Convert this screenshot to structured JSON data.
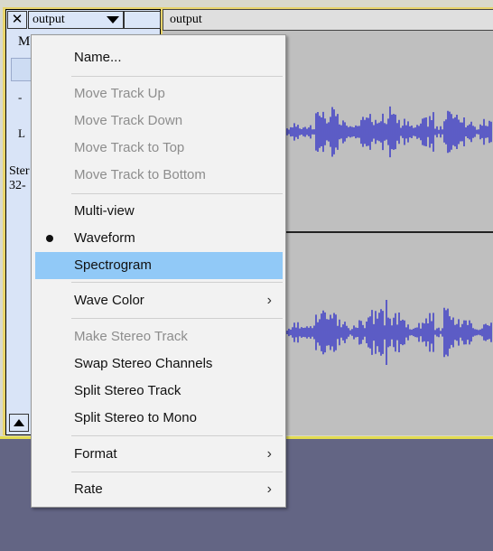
{
  "track": {
    "close_label": "✕",
    "name_label": "output",
    "wave_title": "output",
    "mute_partial": "M",
    "gain_partial": "-",
    "pan_partial": "L",
    "info_line1": "Ster",
    "info_line2": "32-"
  },
  "menu": {
    "items": [
      {
        "label": "Name...",
        "disabled": false
      },
      {
        "label": "Move Track Up",
        "disabled": true
      },
      {
        "label": "Move Track Down",
        "disabled": true
      },
      {
        "label": "Move Track to Top",
        "disabled": true
      },
      {
        "label": "Move Track to Bottom",
        "disabled": true
      },
      {
        "label": "Multi-view",
        "disabled": false
      },
      {
        "label": "Waveform",
        "disabled": false,
        "checked": true
      },
      {
        "label": "Spectrogram",
        "disabled": false,
        "highlighted": true
      },
      {
        "label": "Wave Color",
        "disabled": false,
        "submenu": true
      },
      {
        "label": "Make Stereo Track",
        "disabled": true
      },
      {
        "label": "Swap Stereo Channels",
        "disabled": false
      },
      {
        "label": "Split Stereo Track",
        "disabled": false
      },
      {
        "label": "Split Stereo to Mono",
        "disabled": false
      },
      {
        "label": "Format",
        "disabled": false,
        "submenu": true
      },
      {
        "label": "Rate",
        "disabled": false,
        "submenu": true
      }
    ],
    "submenu_arrow": "›"
  },
  "colors": {
    "waveform": "#3232c8",
    "highlight": "#91c9f7",
    "background": "#636584"
  }
}
